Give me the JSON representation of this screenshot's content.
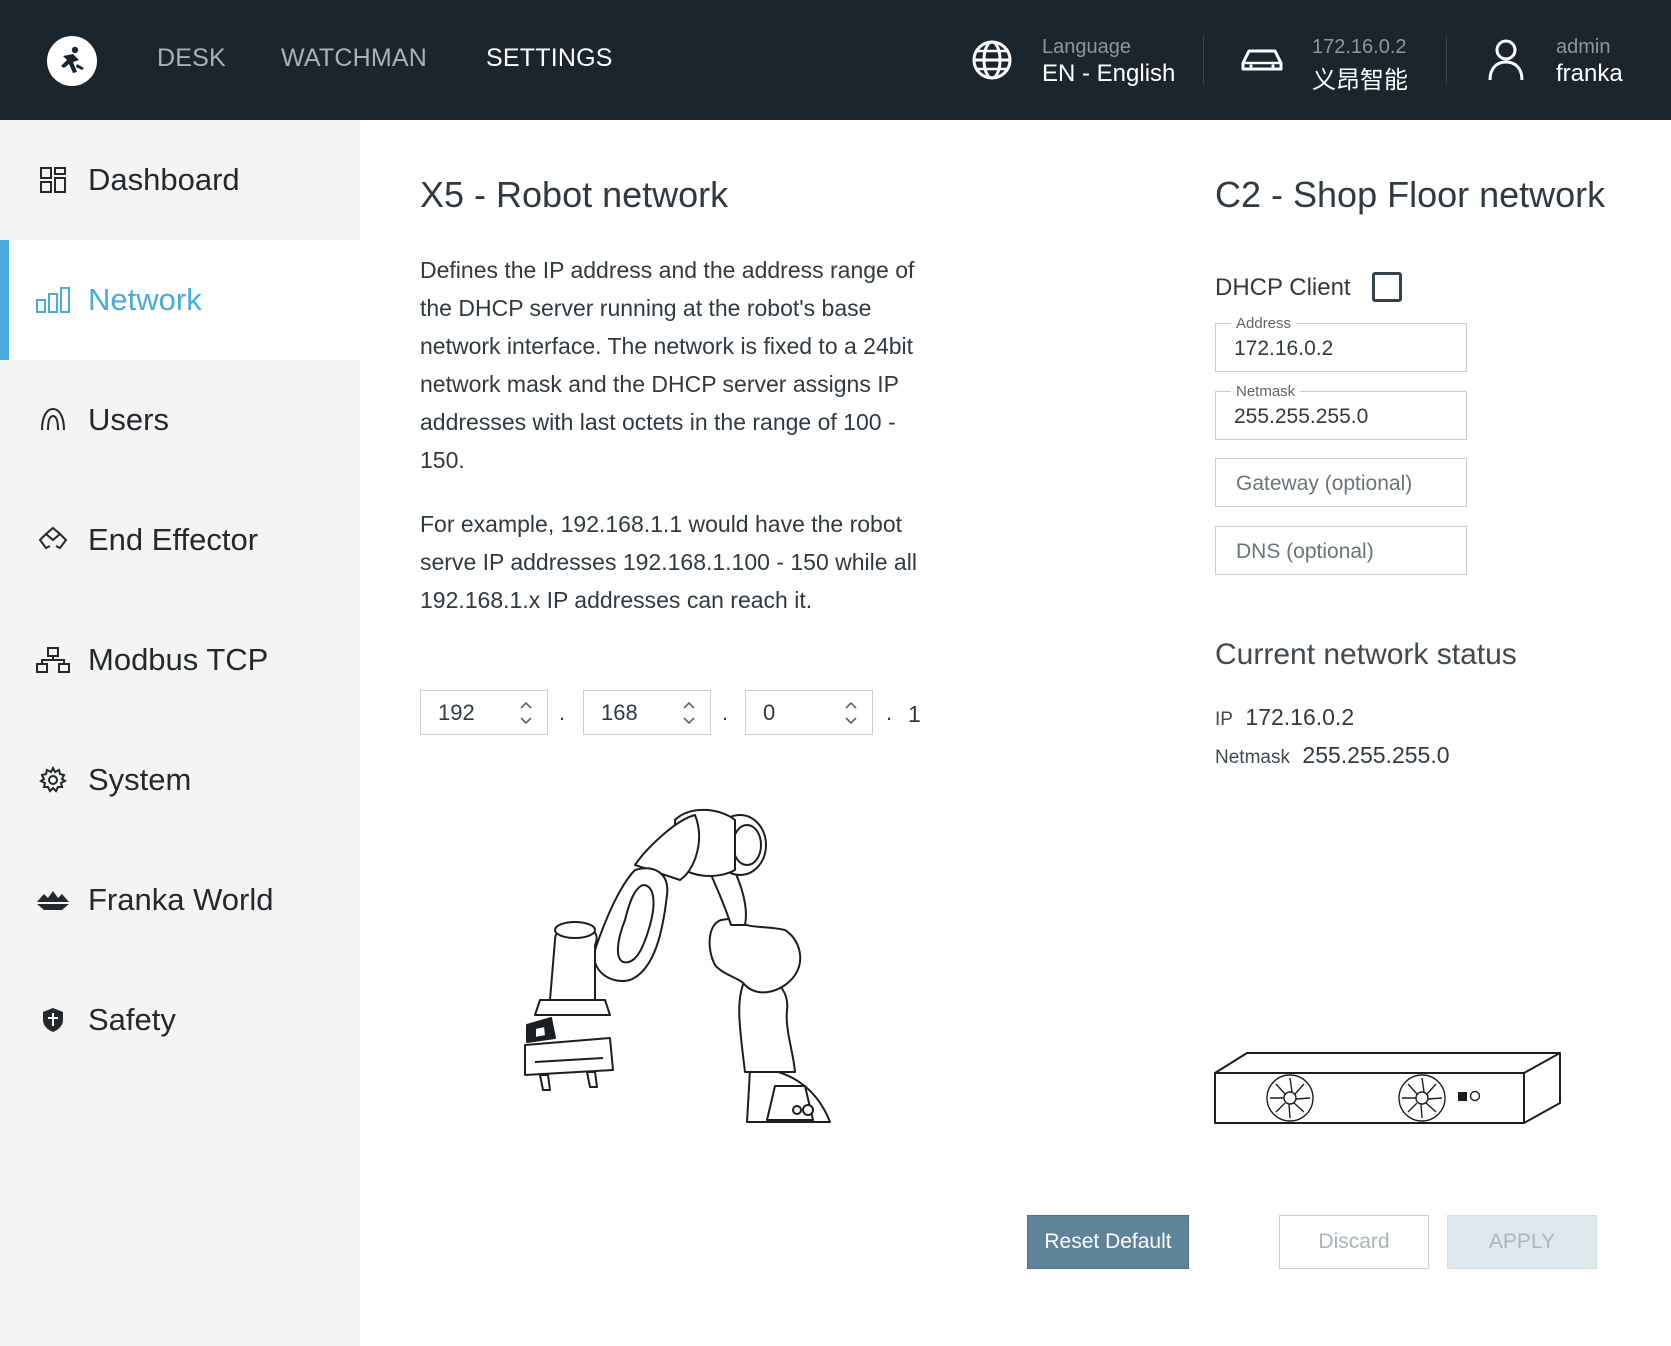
{
  "topbar": {
    "nav": [
      "DESK",
      "WATCHMAN",
      "SETTINGS"
    ],
    "active_nav": "SETTINGS",
    "language": {
      "label": "Language",
      "value": "EN - English",
      "icon": "globe-icon"
    },
    "robot": {
      "ip": "172.16.0.2",
      "name": "义昂智能",
      "icon": "robot-control-icon"
    },
    "user": {
      "role": "admin",
      "name": "franka",
      "icon": "user-icon"
    }
  },
  "sidebar": {
    "items": [
      {
        "label": "Dashboard",
        "icon": "dashboard-icon"
      },
      {
        "label": "Network",
        "icon": "network-icon"
      },
      {
        "label": "Users",
        "icon": "users-icon"
      },
      {
        "label": "End Effector",
        "icon": "end-effector-icon"
      },
      {
        "label": "Modbus TCP",
        "icon": "modbus-icon"
      },
      {
        "label": "System",
        "icon": "gear-icon"
      },
      {
        "label": "Franka World",
        "icon": "franka-world-icon"
      },
      {
        "label": "Safety",
        "icon": "shield-icon"
      }
    ],
    "active": "Network"
  },
  "robot_network": {
    "title": "X5 - Robot network",
    "description_1": "Defines the IP address and the address range of the DHCP server running at the robot's base network interface. The network is fixed to a 24bit network mask and the DHCP server assigns IP addresses with last octets in the range of 100 - 150.",
    "description_2": "For example, 192.168.1.1 would have the robot serve IP addresses 192.168.1.100 - 150 while all 192.168.1.x IP addresses can reach it.",
    "octets": [
      "192",
      "168",
      "0"
    ],
    "separator": ".",
    "last_octet": "1"
  },
  "shop_floor_network": {
    "title": "C2 - Shop Floor network",
    "dhcp_client_label": "DHCP Client",
    "dhcp_client_checked": false,
    "address": {
      "label": "Address",
      "value": "172.16.0.2"
    },
    "netmask": {
      "label": "Netmask",
      "value": "255.255.255.0"
    },
    "gateway": {
      "placeholder": "Gateway (optional)"
    },
    "dns": {
      "placeholder": "DNS (optional)"
    }
  },
  "status": {
    "title": "Current network status",
    "ip_label": "IP",
    "ip_value": "172.16.0.2",
    "netmask_label": "Netmask",
    "netmask_value": "255.255.255.0"
  },
  "actions": {
    "reset": "Reset Default",
    "discard": "Discard",
    "apply": "APPLY"
  },
  "colors": {
    "topbar_bg": "#1b252e",
    "accent": "#49acd9",
    "reset_button": "#5f8499",
    "sidebar_bg": "#f3f4f3"
  }
}
